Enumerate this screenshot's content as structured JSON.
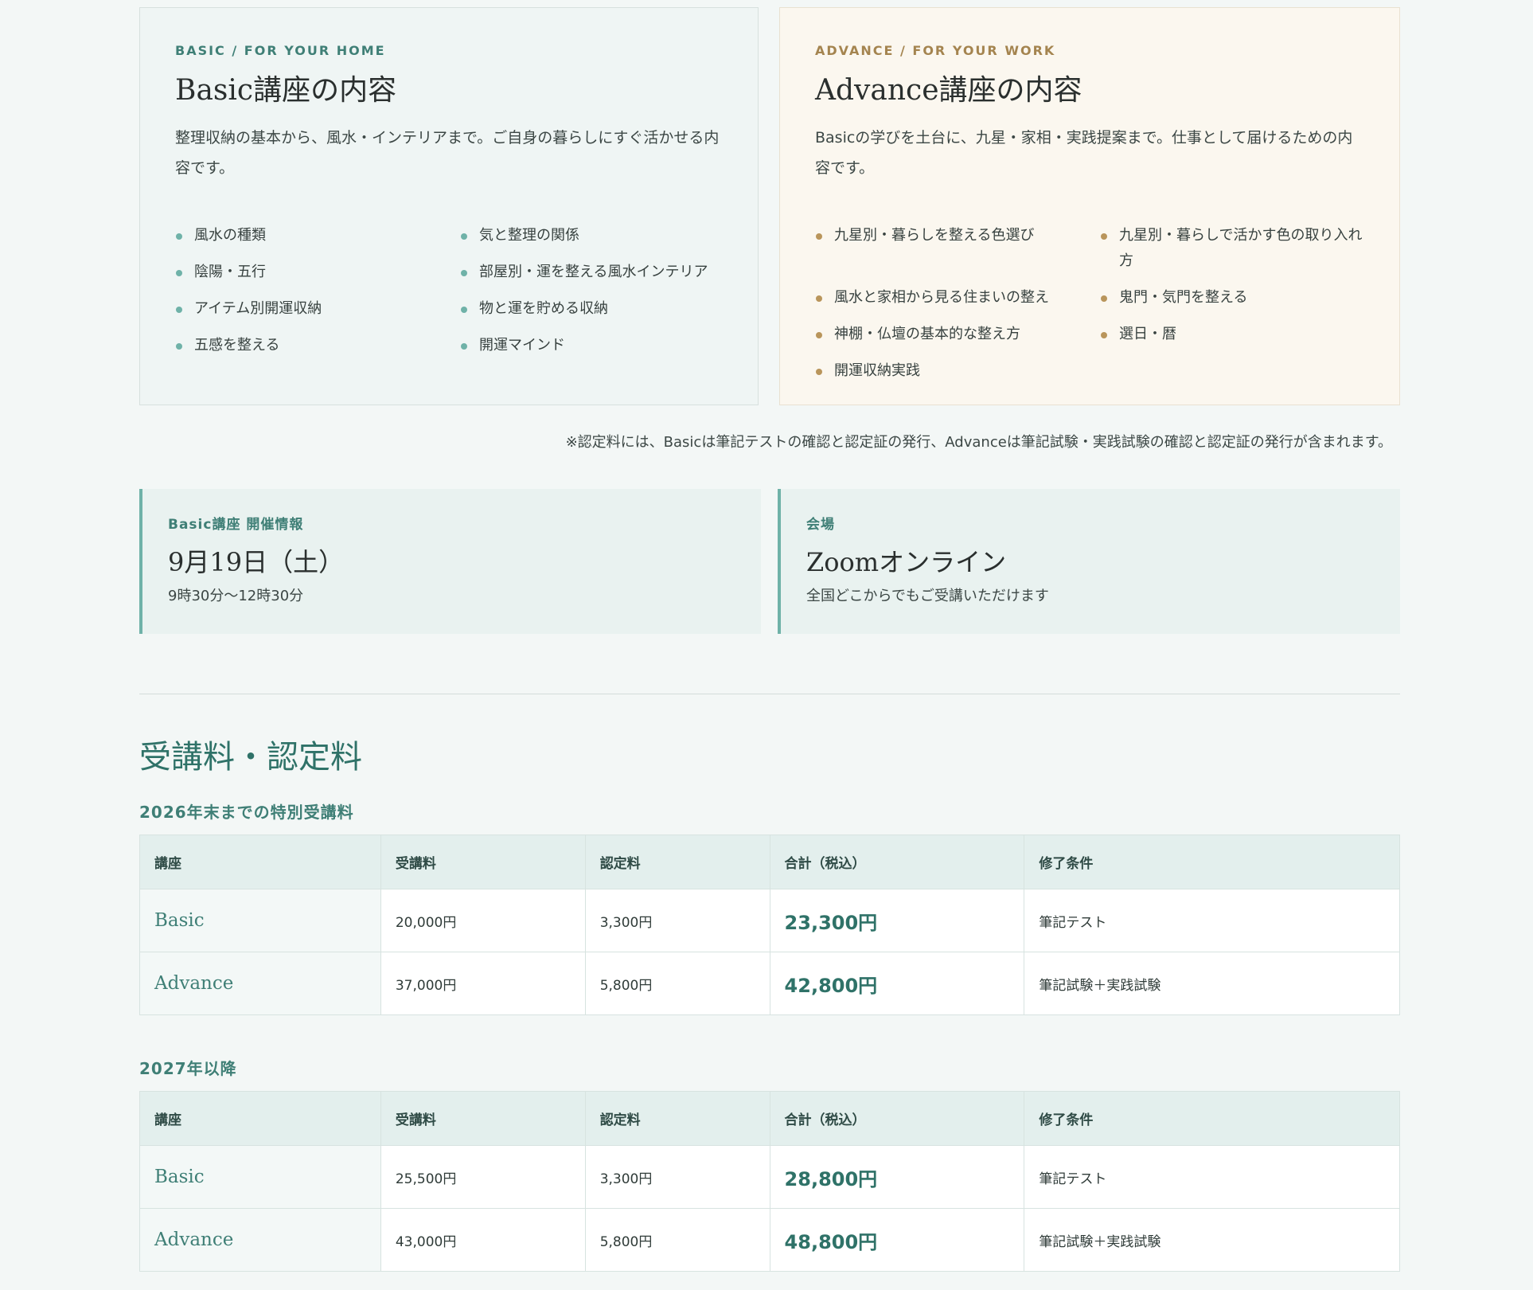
{
  "basic_card": {
    "eyebrow": "BASIC / FOR YOUR HOME",
    "title": "Basic講座の内容",
    "description": "整理収納の基本から、風水・インテリアまで。ご自身の暮らしにすぐ活かせる内容です。",
    "items": [
      "風水の種類",
      "気と整理の関係",
      "陰陽・五行",
      "部屋別・運を整える風水インテリア",
      "アイテム別開運収納",
      "物と運を貯める収納",
      "五感を整える",
      "開運マインド"
    ]
  },
  "advance_card": {
    "eyebrow": "ADVANCE / FOR YOUR WORK",
    "title": "Advance講座の内容",
    "description": "Basicの学びを土台に、九星・家相・実践提案まで。仕事として届けるための内容です。",
    "items": [
      "九星別・暮らしを整える色選び",
      "九星別・暮らしで活かす色の取り入れ方",
      "風水と家相から見る住まいの整え",
      "鬼門・気門を整える",
      "神棚・仏壇の基本的な整え方",
      "選日・暦",
      "開運収納実践"
    ]
  },
  "note": "※認定料には、Basicは筆記テストの確認と認定証の発行、Advanceは筆記試験・実践試験の確認と認定証の発行が含まれます。",
  "schedule": {
    "label": "Basic講座 開催情報",
    "date": "9月19日（土）",
    "time": "9時30分〜12時30分"
  },
  "venue": {
    "label": "会場",
    "name": "Zoomオンライン",
    "description": "全国どこからでもご受講いただけます"
  },
  "fees_section": {
    "title": "受講料・認定料",
    "headers": [
      "講座",
      "受講料",
      "認定料",
      "合計（税込）",
      "修了条件"
    ],
    "special": {
      "title": "2026年末までの特別受講料",
      "rows": [
        {
          "course": "Basic",
          "tuition": "20,000円",
          "certification": "3,300円",
          "total": "23,300円",
          "requirement": "筆記テスト"
        },
        {
          "course": "Advance",
          "tuition": "37,000円",
          "certification": "5,800円",
          "total": "42,800円",
          "requirement": "筆記試験＋実践試験"
        }
      ]
    },
    "regular": {
      "title": "2027年以降",
      "rows": [
        {
          "course": "Basic",
          "tuition": "25,500円",
          "certification": "3,300円",
          "total": "28,800円",
          "requirement": "筆記テスト"
        },
        {
          "course": "Advance",
          "tuition": "43,000円",
          "certification": "5,800円",
          "total": "48,800円",
          "requirement": "筆記試験＋実践試験"
        }
      ]
    }
  },
  "colors": {
    "basic_accent": "#6fb2a8",
    "advance_accent": "#b9955b",
    "heading_green": "#2f7268"
  }
}
